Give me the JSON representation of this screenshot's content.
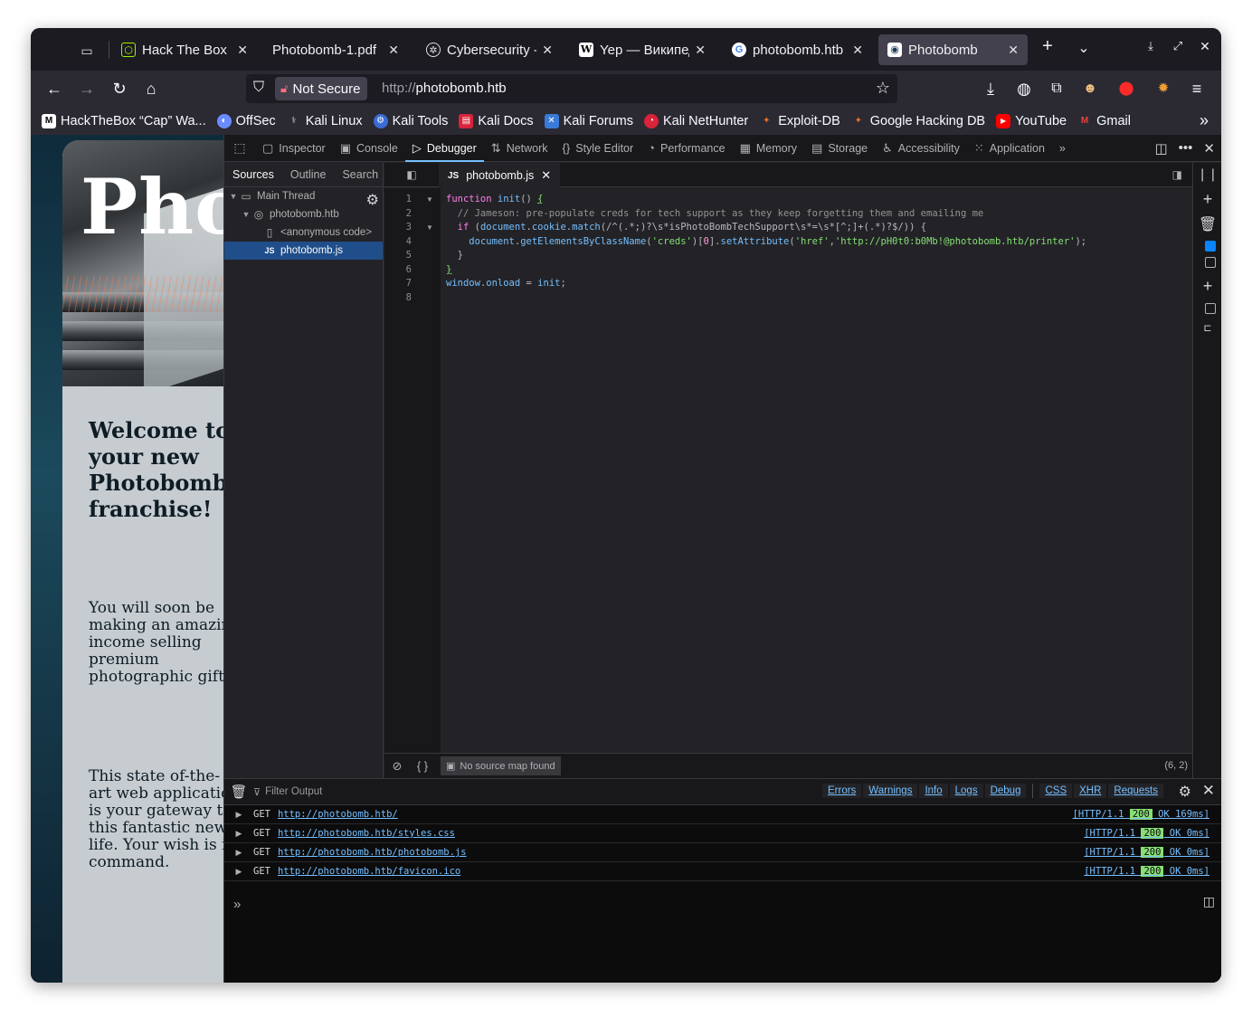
{
  "tabs": [
    {
      "title": "Hack The Box :: H",
      "favicon": "htb-cube-icon",
      "color": "#9fef00"
    },
    {
      "title": "Photobomb-1.pdf",
      "favicon": "pdf-icon",
      "color": "#1c1b22"
    },
    {
      "title": "Cybersecurity - S",
      "favicon": "openai-icon",
      "color": "#1c1b22"
    },
    {
      "title": "Yep — Википеди",
      "favicon": "wikipedia-icon",
      "color": "#ffffff"
    },
    {
      "title": "photobomb.htb -",
      "favicon": "google-icon",
      "color": "#4285f4"
    },
    {
      "title": "Photobomb",
      "favicon": "photobomb-icon",
      "color": "#ffffff",
      "active": true
    }
  ],
  "navbar": {
    "security_label": "Not Secure",
    "url_protocol": "http://",
    "url_host": "photobomb.htb"
  },
  "bookmarks": [
    {
      "label": "HackTheBox “Cap” Wa...",
      "icon": "medium-icon",
      "color": "#ffffff"
    },
    {
      "label": "OffSec",
      "icon": "offsec-icon",
      "color": "#6b8cff"
    },
    {
      "label": "Kali Linux",
      "icon": "kali-dragon-icon",
      "color": "#2b2a33"
    },
    {
      "label": "Kali Tools",
      "icon": "kali-tools-icon",
      "color": "#3a6bd8"
    },
    {
      "label": "Kali Docs",
      "icon": "kali-docs-icon",
      "color": "#d8233a"
    },
    {
      "label": "Kali Forums",
      "icon": "kali-forums-icon",
      "color": "#3a7bd8"
    },
    {
      "label": "Kali NetHunter",
      "icon": "nethunter-icon",
      "color": "#d8233a"
    },
    {
      "label": "Exploit-DB",
      "icon": "exploitdb-icon",
      "color": "#e8702a"
    },
    {
      "label": "Google Hacking DB",
      "icon": "ghdb-icon",
      "color": "#e8702a"
    },
    {
      "label": "YouTube",
      "icon": "youtube-icon",
      "color": "#ff0000"
    },
    {
      "label": "Gmail",
      "icon": "gmail-icon",
      "color": "#ea4335"
    }
  ],
  "page": {
    "hero_title": "Pho",
    "welcome": "Welcome to your new Photobomb franchise!",
    "para1": "You will soon be making an amazing income selling premium photographic gifts.",
    "para2": "This state of-the-art web application is your gateway to this fantastic new life. Your wish is its command."
  },
  "devtools": {
    "tabs": [
      {
        "label": "Inspector",
        "icon": "inspector-icon"
      },
      {
        "label": "Console",
        "icon": "console-icon"
      },
      {
        "label": "Debugger",
        "icon": "debugger-icon",
        "active": true
      },
      {
        "label": "Network",
        "icon": "network-icon"
      },
      {
        "label": "Style Editor",
        "icon": "style-editor-icon"
      },
      {
        "label": "Performance",
        "icon": "performance-icon"
      },
      {
        "label": "Memory",
        "icon": "memory-icon"
      },
      {
        "label": "Storage",
        "icon": "storage-icon"
      },
      {
        "label": "Accessibility",
        "icon": "accessibility-icon"
      },
      {
        "label": "Application",
        "icon": "application-icon"
      }
    ],
    "sources_tabs": [
      "Sources",
      "Outline",
      "Search"
    ],
    "tree": [
      {
        "label": "Main Thread",
        "icon": "window-icon",
        "indent": 0,
        "twisty": "▼"
      },
      {
        "label": "photobomb.htb",
        "icon": "globe-icon",
        "indent": 1,
        "twisty": "▼"
      },
      {
        "label": "<anonymous code>",
        "icon": "file-icon",
        "indent": 2,
        "twisty": ""
      },
      {
        "label": "photobomb.js",
        "icon": "js-file-icon",
        "indent": 2,
        "twisty": "",
        "selected": true
      }
    ],
    "editor_file": "photobomb.js",
    "line_numbers": [
      "1",
      "2",
      "3",
      "4",
      "5",
      "6",
      "7",
      "8"
    ],
    "code": {
      "l1_kw": "function",
      "l1_fn": "init",
      "l1_rest": "() ",
      "l1_brace": "{",
      "l2": "  // Jameson: pre-populate creds for tech support as they keep forgetting them and emailing me",
      "l3_kw": "  if",
      "l3_a": " (",
      "l3_obj": "document",
      "l3_b": ".",
      "l3_fn": "cookie",
      "l3_c": ".",
      "l3_fn2": "match",
      "l3_rest": "(/^(.*;)?\\s*isPhotoBombTechSupport\\s*=\\s*[^;]+(.*)?$/)) {",
      "l4_a": "    ",
      "l4_obj": "document",
      "l4_b": ".",
      "l4_fn": "getElementsByClassName",
      "l4_c": "(",
      "l4_s1": "'creds'",
      "l4_d": ")[",
      "l4_n": "0",
      "l4_e": "].",
      "l4_fn2": "setAttribute",
      "l4_f": "(",
      "l4_s2": "'href'",
      "l4_g": ",",
      "l4_s3": "'http://pH0t0:b0Mb!@photobomb.htb/printer'",
      "l4_h": ");",
      "l5": "  }",
      "l6": "}",
      "l7_obj": "window",
      "l7_b": ".",
      "l7_fn": "onload",
      "l7_c": " = ",
      "l7_fn2": "init",
      "l7_d": ";"
    },
    "no_source_map": "No source map found",
    "cursor_pos": "(6, 2)",
    "console": {
      "filter_placeholder": "Filter Output",
      "levels": [
        "Errors",
        "Warnings",
        "Info",
        "Logs",
        "Debug"
      ],
      "net_levels": [
        "CSS",
        "XHR",
        "Requests"
      ],
      "requests": [
        {
          "method": "GET",
          "url": "http://photobomb.htb/",
          "proto": "[HTTP/1.1 ",
          "code": "200",
          "tail": " OK 169ms]"
        },
        {
          "method": "GET",
          "url": "http://photobomb.htb/styles.css",
          "proto": "[HTTP/1.1 ",
          "code": "200",
          "tail": " OK 0ms]"
        },
        {
          "method": "GET",
          "url": "http://photobomb.htb/photobomb.js",
          "proto": "[HTTP/1.1 ",
          "code": "200",
          "tail": " OK 0ms]"
        },
        {
          "method": "GET",
          "url": "http://photobomb.htb/favicon.ico",
          "proto": "[HTTP/1.1 ",
          "code": "200",
          "tail": " OK 0ms]"
        }
      ]
    }
  }
}
